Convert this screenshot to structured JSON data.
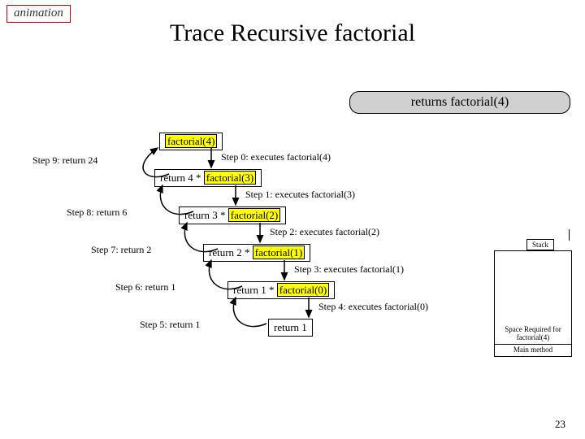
{
  "animation_tag": "animation",
  "title": "Trace Recursive factorial",
  "caption": "returns factorial(4)",
  "page_number": "23",
  "nodes": {
    "n0_call": "factorial(4)",
    "n1_pre": "return 4 * ",
    "n1_call": "factorial(3)",
    "n2_pre": "return 3 * ",
    "n2_call": "factorial(2)",
    "n3_pre": "return 2 * ",
    "n3_call": "factorial(1)",
    "n4_pre": "return 1 * ",
    "n4_call": "factorial(0)",
    "n5": "return 1"
  },
  "steps_down": {
    "s0": "Step 0: executes factorial(4)",
    "s1": "Step 1: executes factorial(3)",
    "s2": "Step 2: executes factorial(2)",
    "s3": "Step 3: executes factorial(1)",
    "s4": "Step 4: executes factorial(0)"
  },
  "steps_up": {
    "s5": "Step 5: return 1",
    "s6": "Step 6: return 1",
    "s7": "Step 7: return 2",
    "s8": "Step 8: return 6",
    "s9": "Step 9: return 24"
  },
  "stack": {
    "label": "Stack",
    "space_required": "Space  Required for factorial(4)",
    "main": "Main method"
  }
}
